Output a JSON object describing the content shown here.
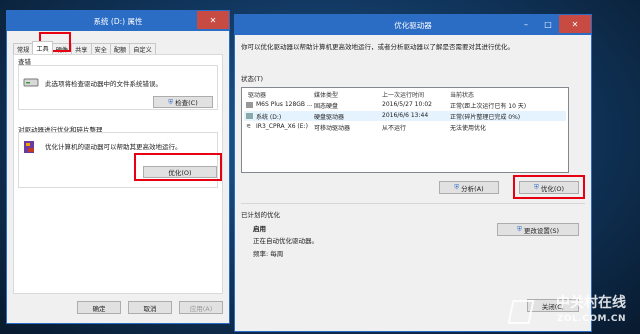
{
  "props": {
    "title": "系统 (D:) 属性",
    "tabs": [
      "常规",
      "工具",
      "硬件",
      "共享",
      "安全",
      "配额",
      "自定义"
    ],
    "active_tab": "工具",
    "check": {
      "heading": "查错",
      "desc": "此选项将检查驱动器中的文件系统错误。",
      "button": "检查(C)"
    },
    "optimize": {
      "heading": "对驱动器进行优化和碎片整理",
      "desc": "优化计算机的驱动器可以帮助其更高效地运行。",
      "button": "优化(O)"
    },
    "footer": {
      "ok": "确定",
      "cancel": "取消",
      "apply": "应用(A)"
    }
  },
  "opt": {
    "title": "优化驱动器",
    "intro": "你可以优化驱动器以帮助计算机更高效地运行，或者分析驱动器以了解是否需要对其进行优化。",
    "status_label": "状态(T)",
    "columns": [
      "驱动器",
      "媒体类型",
      "上一次运行时间",
      "当前状态"
    ],
    "drives": [
      {
        "name": "M6S Plus 128GB ...",
        "media": "固态硬盘",
        "last": "2016/5/27 10:02",
        "status": "正常(距上次运行已有 10 天)"
      },
      {
        "name": "系统 (D:)",
        "media": "硬盘驱动器",
        "last": "2016/6/6 13:44",
        "status": "正常(碎片整理已完成 0%)"
      },
      {
        "name": "IR3_CPRA_X6 (E:)",
        "media": "可移动驱动器",
        "last": "从不运行",
        "status": "无法使用优化"
      }
    ],
    "analyze_btn": "分析(A)",
    "optimize_btn": "优化(O)",
    "scheduled": {
      "heading": "已计划的优化",
      "state": "启用",
      "desc": "正在自动优化驱动器。",
      "freq": "频率: 每周",
      "change_btn": "更改设置(S)"
    },
    "close_btn": "关闭(C)"
  },
  "watermark": {
    "brand": "中关村在线",
    "site": "ZOL.COM.CN"
  },
  "colors": {
    "titlebar_blue": "#2b6cc4",
    "highlight_red": "#e60012",
    "desktop": "#123a64"
  }
}
